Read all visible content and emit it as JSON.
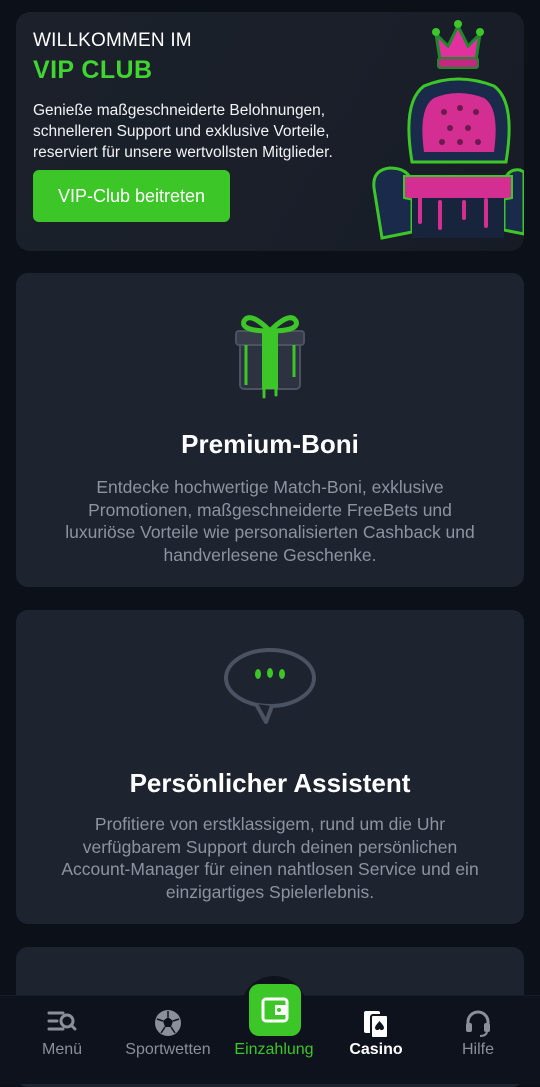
{
  "hero": {
    "pretitle": "WILLKOMMEN IM",
    "title": "VIP CLUB",
    "description": "Genieße maßgeschneiderte Belohnungen, schnelleren Support und exklusive Vorteile, reserviert für unsere wertvollsten Mitglieder.",
    "cta_label": "VIP-Club beitreten"
  },
  "cards": [
    {
      "icon": "gift-icon",
      "title": "Premium-Boni",
      "text": "Entdecke hochwertige Match-Boni, exklusive Promotionen, maßgeschneiderte FreeBets und luxuriöse Vorteile wie personalisierten Cashback und handverlesene Geschenke."
    },
    {
      "icon": "chat-bubble-icon",
      "title": "Persönlicher Assistent",
      "text": "Profitiere von erstklassigem, rund um die Uhr verfügbarem Support durch deinen persönlichen Account-Manager für einen nahtlosen Service und ein einzigartiges Spielerlebnis."
    }
  ],
  "bottom_nav": {
    "items": [
      {
        "label": "Menü",
        "icon": "menu-search-icon",
        "active": false
      },
      {
        "label": "Sportwetten",
        "icon": "soccer-ball-icon",
        "active": false
      },
      {
        "label": "Einzahlung",
        "icon": "wallet-icon",
        "active": false
      },
      {
        "label": "Casino",
        "icon": "playing-cards-icon",
        "active": true
      },
      {
        "label": "Hilfe",
        "icon": "headset-icon",
        "active": false
      }
    ]
  },
  "colors": {
    "accent_green": "#3cc628",
    "title_green": "#40d530",
    "card_bg": "#1e2330",
    "page_bg": "#0b1019",
    "muted_text": "#8d939f",
    "throne_pink": "#e0319e"
  }
}
